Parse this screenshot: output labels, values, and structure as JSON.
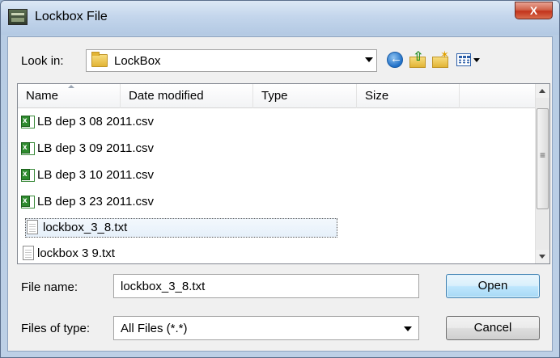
{
  "window": {
    "title": "Lockbox File",
    "close_label": "X"
  },
  "lookin": {
    "label": "Look in:",
    "value": "LockBox"
  },
  "toolbar": {
    "icons": [
      "back-icon",
      "up-folder-icon",
      "new-folder-icon",
      "views-menu-icon"
    ]
  },
  "columns": {
    "name": "Name",
    "date_modified": "Date modified",
    "type": "Type",
    "size": "Size"
  },
  "files": [
    {
      "name": "LB dep 3 08 2011.csv",
      "icon": "csv-file-icon"
    },
    {
      "name": "LB dep 3 09 2011.csv",
      "icon": "csv-file-icon"
    },
    {
      "name": "LB dep 3 10 2011.csv",
      "icon": "csv-file-icon"
    },
    {
      "name": "LB dep 3 23 2011.csv",
      "icon": "csv-file-icon"
    },
    {
      "name": "lockbox_3_8.txt",
      "icon": "text-file-icon",
      "selected": true
    },
    {
      "name": "lockbox 3 9.txt",
      "icon": "text-file-icon"
    }
  ],
  "filename": {
    "label": "File name:",
    "value": "lockbox_3_8.txt"
  },
  "filetype": {
    "label": "Files of type:",
    "value": "All Files (*.*)"
  },
  "buttons": {
    "open": "Open",
    "cancel": "Cancel"
  },
  "colors": {
    "title_bar": "#c4d6ec",
    "close_button": "#c2341c",
    "selection_fill": "#e6f0fa",
    "open_button": "#bee6fd"
  }
}
